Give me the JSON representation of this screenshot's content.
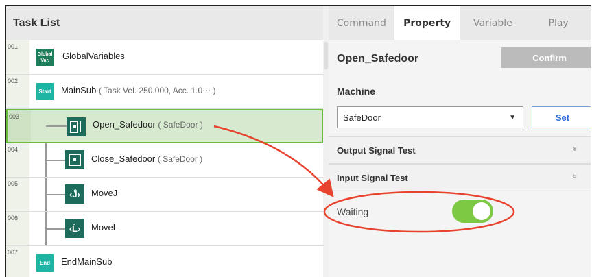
{
  "task_list": {
    "title": "Task List",
    "rows": [
      {
        "num": "001",
        "tag": "Global Var.",
        "label": "GlobalVariables",
        "sub": ""
      },
      {
        "num": "002",
        "tag": "Start",
        "label": "MainSub",
        "sub": "( Task Vel. 250.000, Acc. 1.0⋯ )"
      },
      {
        "num": "003",
        "tag": "",
        "label": "Open_Safedoor",
        "sub": "( SafeDoor )"
      },
      {
        "num": "004",
        "tag": "",
        "label": "Close_Safedoor",
        "sub": "( SafeDoor )"
      },
      {
        "num": "005",
        "tag": "",
        "label": "MoveJ",
        "sub": ""
      },
      {
        "num": "006",
        "tag": "",
        "label": "MoveL",
        "sub": ""
      },
      {
        "num": "007",
        "tag": "End",
        "label": "EndMainSub",
        "sub": ""
      }
    ]
  },
  "tabs": [
    "Command",
    "Property",
    "Variable",
    "Play"
  ],
  "active_tab": "Property",
  "property": {
    "title": "Open_Safedoor",
    "confirm_label": "Confirm",
    "machine_label": "Machine",
    "machine_value": "SafeDoor",
    "set_label": "Set",
    "output_signal_test": "Output Signal Test",
    "input_signal_test": "Input Signal Test",
    "chevron": "»",
    "waiting_label": "Waiting",
    "waiting_on": true
  },
  "colors": {
    "accent_teal": "#1fb5a5",
    "selected_green": "#d7e9cf",
    "toggle_green": "#7ec943",
    "annotation_red": "#e8432e"
  }
}
